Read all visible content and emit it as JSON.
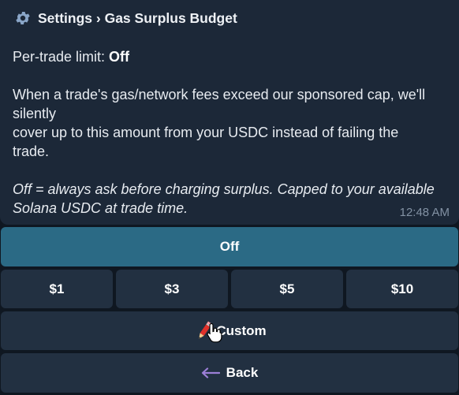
{
  "header": {
    "icon": "gear-icon",
    "breadcrumb": "Settings › Gas Surplus Budget"
  },
  "message": {
    "limit_label": "Per-trade limit: ",
    "limit_value": "Off",
    "description_lines": [
      "When a trade's gas/network fees exceed our sponsored cap, we'll",
      "silently",
      "cover up to this amount from your USDC instead of failing the",
      "trade."
    ],
    "note_lines": [
      "Off = always ask before charging surplus. Capped to your available",
      "Solana USDC at trade time."
    ],
    "timestamp": "12:48 AM"
  },
  "keyboard": {
    "off_label": "Off",
    "amounts": [
      "$1",
      "$3",
      "$5",
      "$10"
    ],
    "custom_label": "Custom",
    "custom_icon": "pencil-icon",
    "back_label": "Back",
    "back_icon": "arrow-left-icon"
  },
  "colors": {
    "active_button": "#2b6a85",
    "button": "#223041",
    "bubble": "#1c2838",
    "background": "#0f1721"
  }
}
